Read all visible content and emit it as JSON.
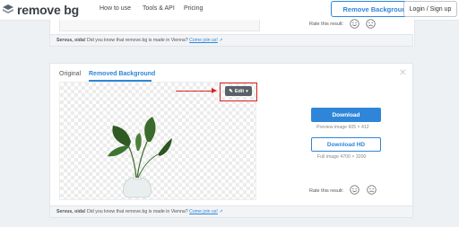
{
  "nav": {
    "logo_text": "remove bg",
    "links": [
      "How to use",
      "Tools & API",
      "Pricing"
    ],
    "remove_background_label": "Remove Background",
    "login_label": "Login / Sign up"
  },
  "card1": {
    "rate_label": "Rate this result:",
    "servus_strong": "Servus, oida!",
    "servus_text": "Did you know that remove.bg is made in Vienna?",
    "servus_link": "Come join us!"
  },
  "card2": {
    "tabs": [
      "Original",
      "Removed Background"
    ],
    "active_tab": "Removed Background",
    "edit_label": "Edit",
    "download_label": "Download",
    "preview_text": "Preview image 605 × 412",
    "download_hd_label": "Download HD",
    "full_image_text": "Full image 4700 × 3200",
    "rate_label": "Rate this result:",
    "servus_strong": "Servus, oida!",
    "servus_text": "Did you know that remove.bg is made in Vienna?",
    "servus_link": "Come join us!"
  },
  "colors": {
    "brand_blue": "#2f86d9",
    "highlight_red": "#e02020",
    "edit_button": "#5b6168"
  },
  "icons": [
    "logo-icon",
    "pencil-icon",
    "chevron-down-icon",
    "close-icon",
    "smile-icon",
    "frown-icon",
    "external-link-icon"
  ]
}
